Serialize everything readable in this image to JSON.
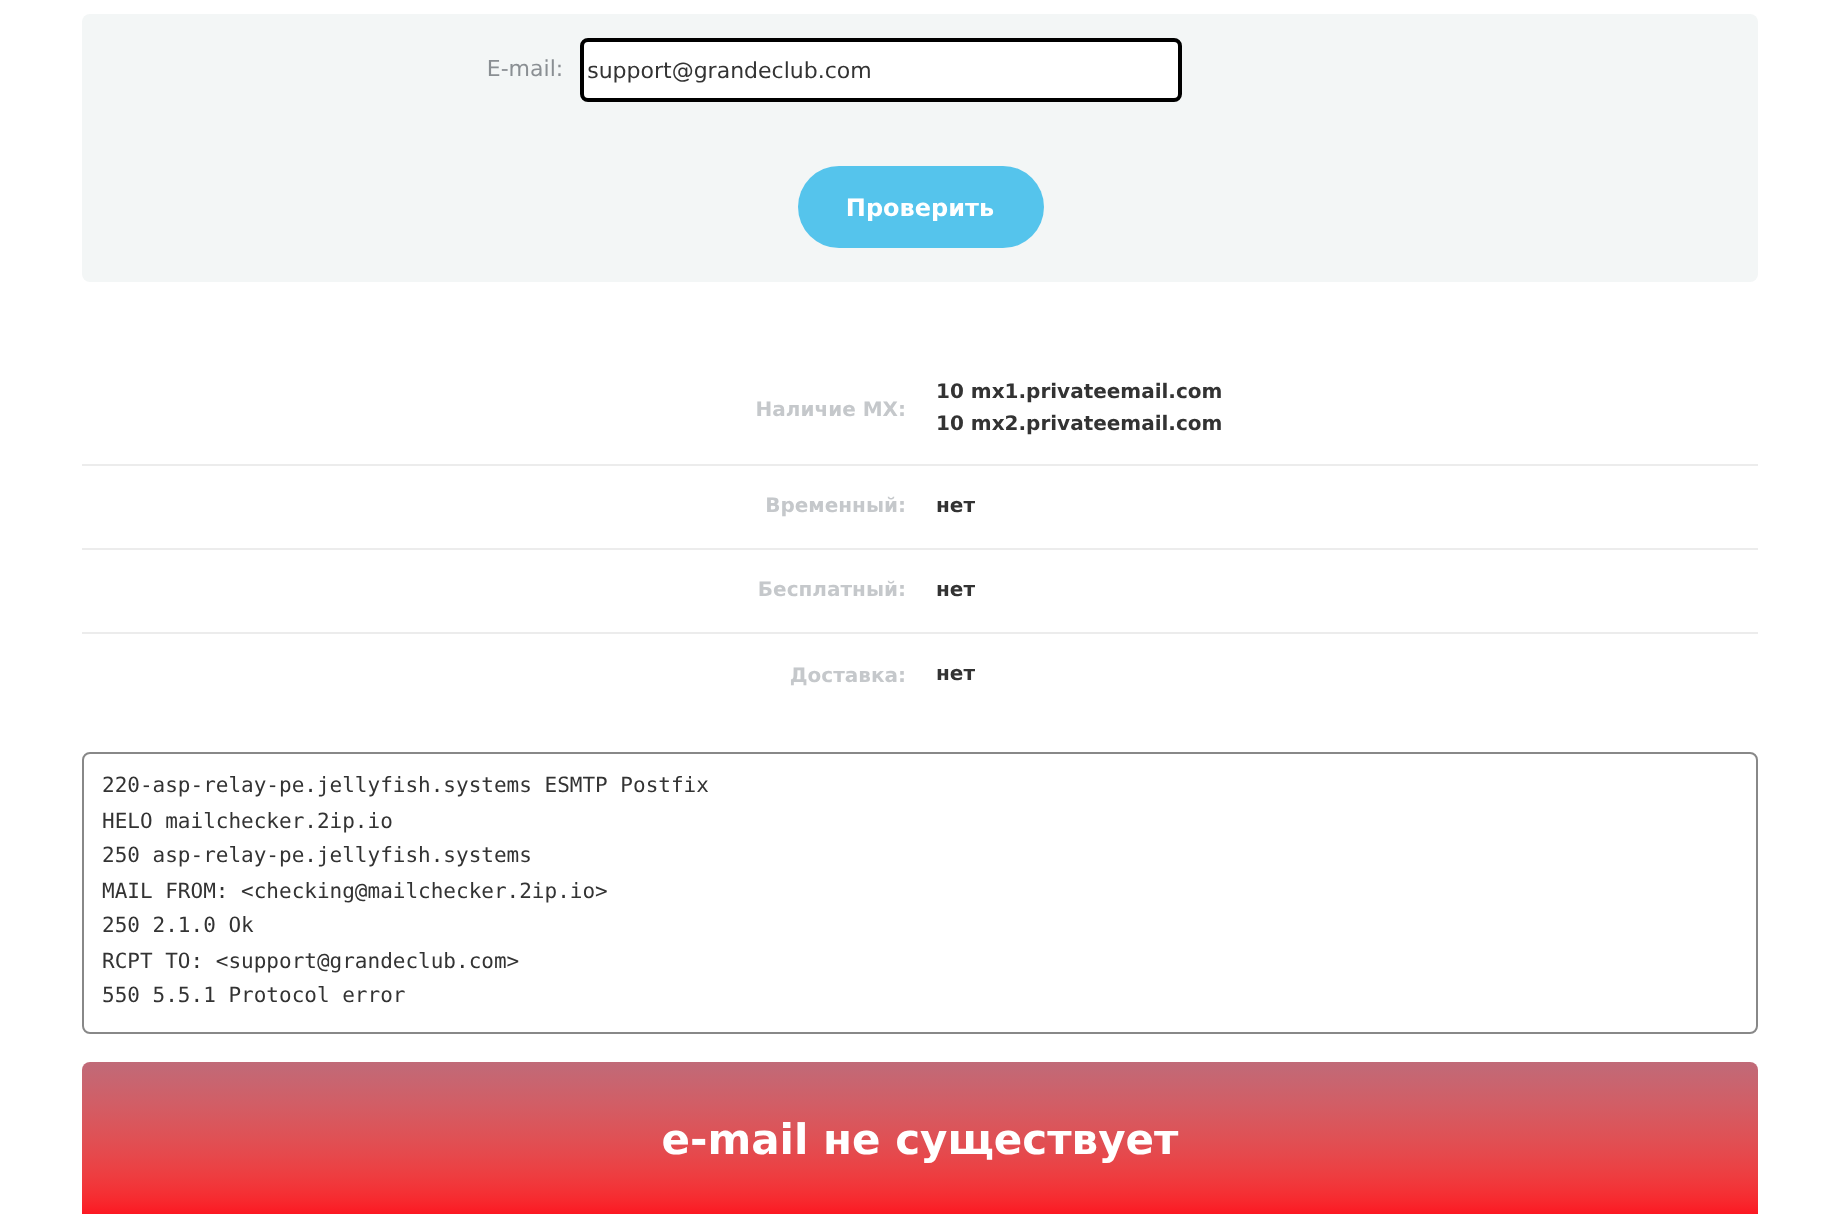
{
  "form": {
    "label": "E-mail:",
    "value": "support@grandeclub.com",
    "button": "Проверить"
  },
  "results": [
    {
      "label": "Наличие MX:",
      "values": [
        "**10** mx1.privateemail.com",
        "**10** mx2.privateemail.com"
      ]
    },
    {
      "label": "Временный:",
      "values": [
        "нет"
      ]
    },
    {
      "label": "Бесплатный:",
      "values": [
        "нет"
      ]
    },
    {
      "label": "Доставка:",
      "values": [
        "нет"
      ]
    }
  ],
  "log": [
    "220-asp-relay-pe.jellyfish.systems ESMTP Postfix",
    "HELO mailchecker.2ip.io",
    "250 asp-relay-pe.jellyfish.systems",
    "MAIL FROM: <checking@mailchecker.2ip.io>",
    "250 2.1.0 Ok",
    "RCPT TO: <support@grandeclub.com>",
    "550 5.5.1 Protocol error"
  ],
  "verdict": {
    "text": "e-mail не существует",
    "exists": false
  }
}
